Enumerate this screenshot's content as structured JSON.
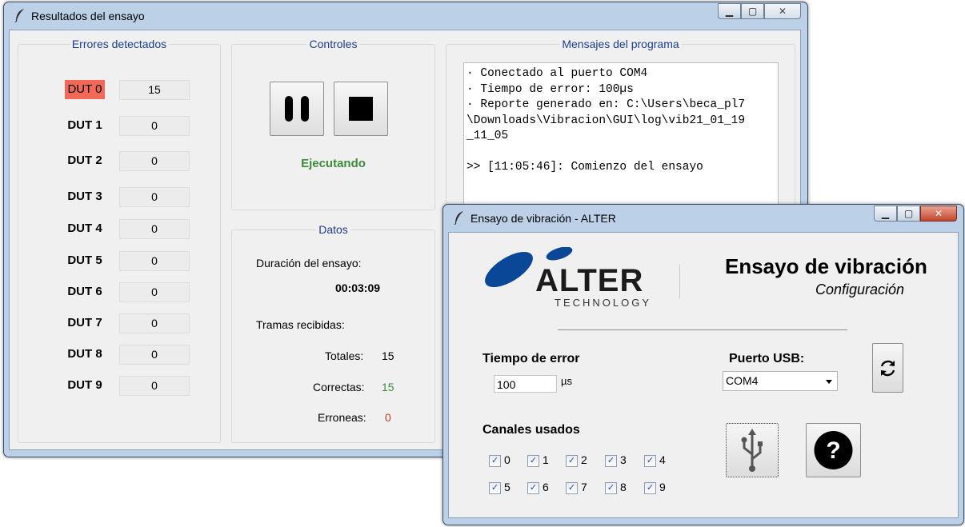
{
  "results_window": {
    "title": "Resultados del ensayo",
    "errors_group": {
      "label": "Errores detectados",
      "duts": [
        {
          "label": "DUT 0",
          "count": "15",
          "error": true
        },
        {
          "label": "DUT 1",
          "count": "0"
        },
        {
          "label": "DUT 2",
          "count": "0"
        },
        {
          "label": "DUT 3",
          "count": "0"
        },
        {
          "label": "DUT 4",
          "count": "0"
        },
        {
          "label": "DUT 5",
          "count": "0"
        },
        {
          "label": "DUT 6",
          "count": "0"
        },
        {
          "label": "DUT 7",
          "count": "0"
        },
        {
          "label": "DUT 8",
          "count": "0"
        },
        {
          "label": "DUT 9",
          "count": "0"
        }
      ]
    },
    "controls_group": {
      "label": "Controles",
      "status": "Ejecutando",
      "status_color": "#3c8c3c"
    },
    "messages_group": {
      "label": "Mensajes del programa",
      "lines": [
        "· Conectado al puerto COM4",
        "· Tiempo de error: 100µs",
        "· Reporte generado en: C:\\Users\\beca_pl7",
        "\\Downloads\\Vibracion\\GUI\\log\\vib21_01_19",
        "_11_05",
        "",
        ">> [11:05:46]: Comienzo del ensayo"
      ]
    },
    "data_group": {
      "label": "Datos",
      "duration_label": "Duración del ensayo:",
      "duration_value": "00:03:09",
      "frames_label": "Tramas recibidas:",
      "total_label": "Totales:",
      "total_value": "15",
      "correct_label": "Correctas:",
      "correct_value": "15",
      "wrong_label": "Erroneas:",
      "wrong_value": "0",
      "correct_color": "#3c8c3c",
      "wrong_color": "#c0392b"
    }
  },
  "config_window": {
    "title": "Ensayo de vibración - ALTER",
    "logo": {
      "brand": "ALTER",
      "sub": "TECHNOLOGY"
    },
    "heading": "Ensayo de vibración",
    "subheading": "Configuración",
    "error_time": {
      "label": "Tiempo de error",
      "value": "100",
      "unit": "µs"
    },
    "usb": {
      "label": "Puerto USB:",
      "selected": "COM4"
    },
    "channels": {
      "label": "Canales usados",
      "items": [
        "0",
        "1",
        "2",
        "3",
        "4",
        "5",
        "6",
        "7",
        "8",
        "9"
      ]
    },
    "icons": [
      "refresh-icon",
      "usb-icon",
      "help-icon"
    ]
  },
  "accent_colors": {
    "error_red": "#f26a57",
    "group_label_blue": "#1c3e8e",
    "logo_blue": "#0a4796"
  }
}
